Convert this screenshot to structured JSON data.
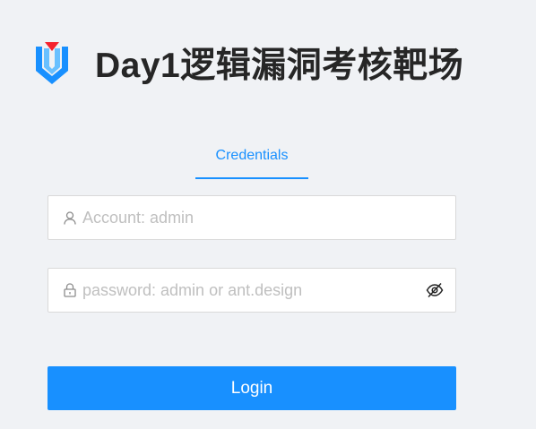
{
  "header": {
    "title": "Day1逻辑漏洞考核靶场",
    "logo_icon": "shield-v-logo-icon"
  },
  "tabs": [
    {
      "label": "Credentials",
      "active": true
    }
  ],
  "form": {
    "account": {
      "placeholder": "Account: admin",
      "value": "",
      "icon": "user-icon"
    },
    "password": {
      "placeholder": "password: admin or ant.design",
      "value": "",
      "icon": "lock-icon",
      "toggle_icon": "eye-invisible-icon"
    },
    "submit_label": "Login"
  },
  "colors": {
    "primary": "#1890ff",
    "background": "#f0f2f5",
    "title_text": "#262626",
    "placeholder": "#bfbfbf",
    "border": "#d9d9d9",
    "logo_blue": "#1890ff",
    "logo_red": "#f5222d"
  }
}
